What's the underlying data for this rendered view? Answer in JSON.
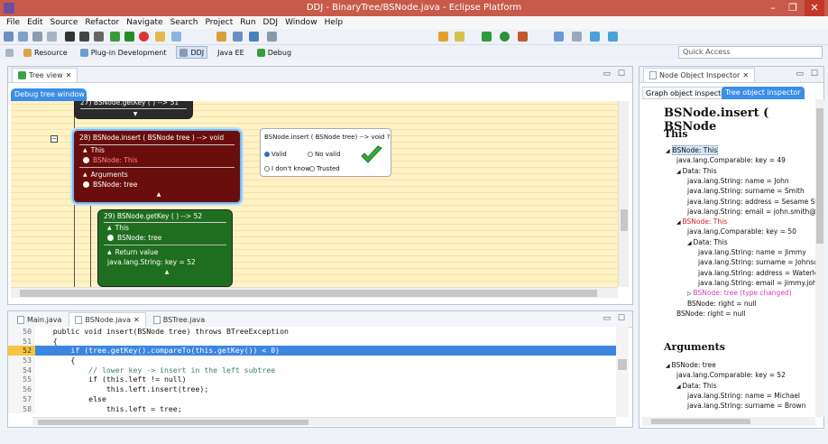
{
  "window": {
    "title": "DDJ - BinaryTree/BSNode.java - Eclipse Platform"
  },
  "menu": [
    "File",
    "Edit",
    "Source",
    "Refactor",
    "Navigate",
    "Search",
    "Project",
    "Run",
    "DDJ",
    "Window",
    "Help"
  ],
  "quick_access": "Quick Access",
  "perspectives": [
    {
      "label": "Resource"
    },
    {
      "label": "Plug-in Development"
    },
    {
      "label": "DDJ"
    },
    {
      "label": "Java EE"
    },
    {
      "label": "Debug"
    }
  ],
  "tree_view": {
    "tab": "Tree view",
    "debug_tab": "Debug tree window"
  },
  "nodes": {
    "n27": {
      "header": "27) BSNode.getKey ( ) --> 51"
    },
    "n28": {
      "header": "28) BSNode.insert ( BSNode tree ) --> void",
      "this_label": "This",
      "this_value": "BSNode: This",
      "args_label": "Arguments",
      "args_value": "BSNode: tree"
    },
    "n29": {
      "header": "29) BSNode.getKey ( ) --> 52",
      "this_label": "This",
      "this_value": "BSNode: tree",
      "ret_label": "Return value",
      "ret_value": "java.lang.String: key = 52"
    }
  },
  "popup": {
    "question": "BSNode.insert ( BSNode tree) --> void ?",
    "valid": "Valid",
    "no_valid": "No valid",
    "dont_know": "I don't know",
    "trusted": "Trusted"
  },
  "editor": {
    "tabs": [
      {
        "label": "Main.java"
      },
      {
        "label": "BSNode.java"
      },
      {
        "label": "BSTree.java"
      }
    ],
    "lines": [
      {
        "n": "50",
        "t": "    public void insert(BSNode tree) throws BTreeException"
      },
      {
        "n": "51",
        "t": "    {"
      },
      {
        "n": "52",
        "t": "        if (tree.getKey().compareTo(this.getKey()) < 0)"
      },
      {
        "n": "53",
        "t": "        {"
      },
      {
        "n": "54",
        "t": "            // lower key -> insert in the left subtree"
      },
      {
        "n": "55",
        "t": "            if (this.left != null)"
      },
      {
        "n": "56",
        "t": "                this.left.insert(tree);"
      },
      {
        "n": "57",
        "t": "            else"
      },
      {
        "n": "58",
        "t": "                this.left = tree;"
      }
    ]
  },
  "inspector": {
    "tab": "Node Object Inspector",
    "subtab_graph": "Graph object inspector",
    "subtab_tree": "Tree object inspector",
    "heading": "BSNode.insert ( BSNode",
    "this_heading": "This",
    "args_heading": "Arguments",
    "this_items": [
      {
        "text": "BSNode: This",
        "lvl": 0,
        "style": "sel"
      },
      {
        "text": "java.lang.Comparable: key = 49",
        "lvl": 1
      },
      {
        "text": "Data: This",
        "lvl": 1,
        "style": "tri"
      },
      {
        "text": "java.lang.String: name = John",
        "lvl": 2
      },
      {
        "text": "java.lang.String: surname = Smith",
        "lvl": 2
      },
      {
        "text": "java.lang.String: address = Sesame Stree",
        "lvl": 2
      },
      {
        "text": "java.lang.String: email = john.smith@tes",
        "lvl": 2
      },
      {
        "text": "BSNode: This",
        "lvl": 1,
        "style": "red"
      },
      {
        "text": "java.lang.Comparable: key = 50",
        "lvl": 2
      },
      {
        "text": "Data: This",
        "lvl": 2,
        "style": "tri"
      },
      {
        "text": "java.lang.String: name = Jimmy",
        "lvl": 3
      },
      {
        "text": "java.lang.String: surname = Johnson",
        "lvl": 3
      },
      {
        "text": "java.lang.String: address = Waterloo",
        "lvl": 3
      },
      {
        "text": "java.lang.String: email = jimmy.john",
        "lvl": 3
      },
      {
        "text": "BSNode: tree (type changed)",
        "lvl": 2,
        "style": "pink"
      },
      {
        "text": "BSNode: right = null",
        "lvl": 2
      },
      {
        "text": "BSNode: right = null",
        "lvl": 1
      }
    ],
    "arg_items": [
      {
        "text": "BSNode: tree",
        "lvl": 0,
        "style": "tri"
      },
      {
        "text": "java.lang.Comparable: key = 52",
        "lvl": 1
      },
      {
        "text": "Data: This",
        "lvl": 1,
        "style": "tri"
      },
      {
        "text": "java.lang.String: name = Michael",
        "lvl": 2
      },
      {
        "text": "java.lang.String: surname = Brown",
        "lvl": 2
      }
    ]
  }
}
